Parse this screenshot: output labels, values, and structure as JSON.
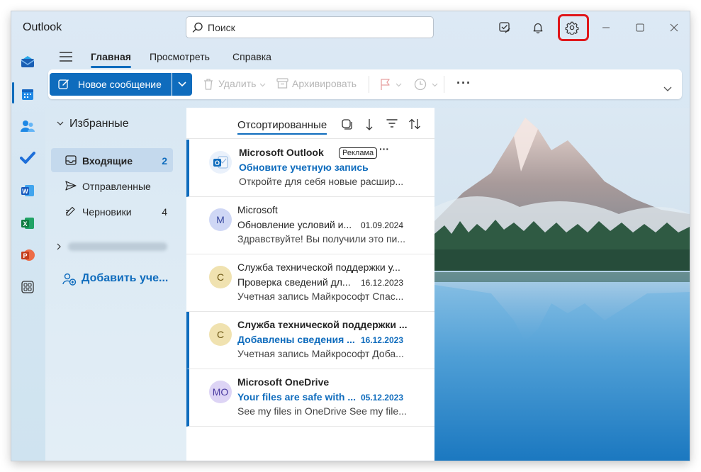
{
  "app": {
    "title": "Outlook"
  },
  "search": {
    "placeholder": "Поиск"
  },
  "ribbon": {
    "tabs": [
      {
        "label": "Главная",
        "active": true
      },
      {
        "label": "Просмотреть",
        "active": false
      },
      {
        "label": "Справка",
        "active": false
      }
    ],
    "new_message_label": "Новое сообщение",
    "delete_label": "Удалить",
    "archive_label": "Архивировать",
    "more_label": "···"
  },
  "folders": {
    "favorites_label": "Избранные",
    "items": [
      {
        "name": "Входящие",
        "count": "2",
        "selected": true
      },
      {
        "name": "Отправленные",
        "count": "",
        "selected": false
      },
      {
        "name": "Черновики",
        "count": "4",
        "selected": false
      }
    ],
    "add_account_label": "Добавить уче..."
  },
  "message_list": {
    "sort_label": "Отсортированные",
    "messages": [
      {
        "sender": "Microsoft Outlook",
        "badge": "Реклама",
        "subject": "Обновите учетную запись",
        "date": "",
        "preview": "Откройте для себя новые расшир...",
        "unread": true,
        "avatar_text": "",
        "avatar_color": "#e8f0fa"
      },
      {
        "sender": "Microsoft",
        "badge": "",
        "subject": "Обновление условий и...",
        "date": "01.09.2024",
        "preview": "Здравствуйте! Вы получили это пи...",
        "unread": false,
        "avatar_text": "M",
        "avatar_color": "#cfd7f5"
      },
      {
        "sender": "Служба технической поддержки у...",
        "badge": "",
        "subject": "Проверка сведений дл...",
        "date": "16.12.2023",
        "preview": "Учетная запись Майкрософт Спас...",
        "unread": false,
        "avatar_text": "С",
        "avatar_color": "#f0e2b0"
      },
      {
        "sender": "Служба технической поддержки ...",
        "badge": "",
        "subject": "Добавлены сведения ...",
        "date": "16.12.2023",
        "preview": "Учетная запись Майкрософт Доба...",
        "unread": true,
        "avatar_text": "С",
        "avatar_color": "#f0e2b0"
      },
      {
        "sender": "Microsoft OneDrive",
        "badge": "",
        "subject": "Your files are safe with ...",
        "date": "05.12.2023",
        "preview": "See my files in OneDrive See my file...",
        "unread": true,
        "avatar_text": "MO",
        "avatar_color": "#ddd4f5"
      }
    ]
  },
  "colors": {
    "accent": "#0f6cbd",
    "highlight": "#e0171b"
  }
}
